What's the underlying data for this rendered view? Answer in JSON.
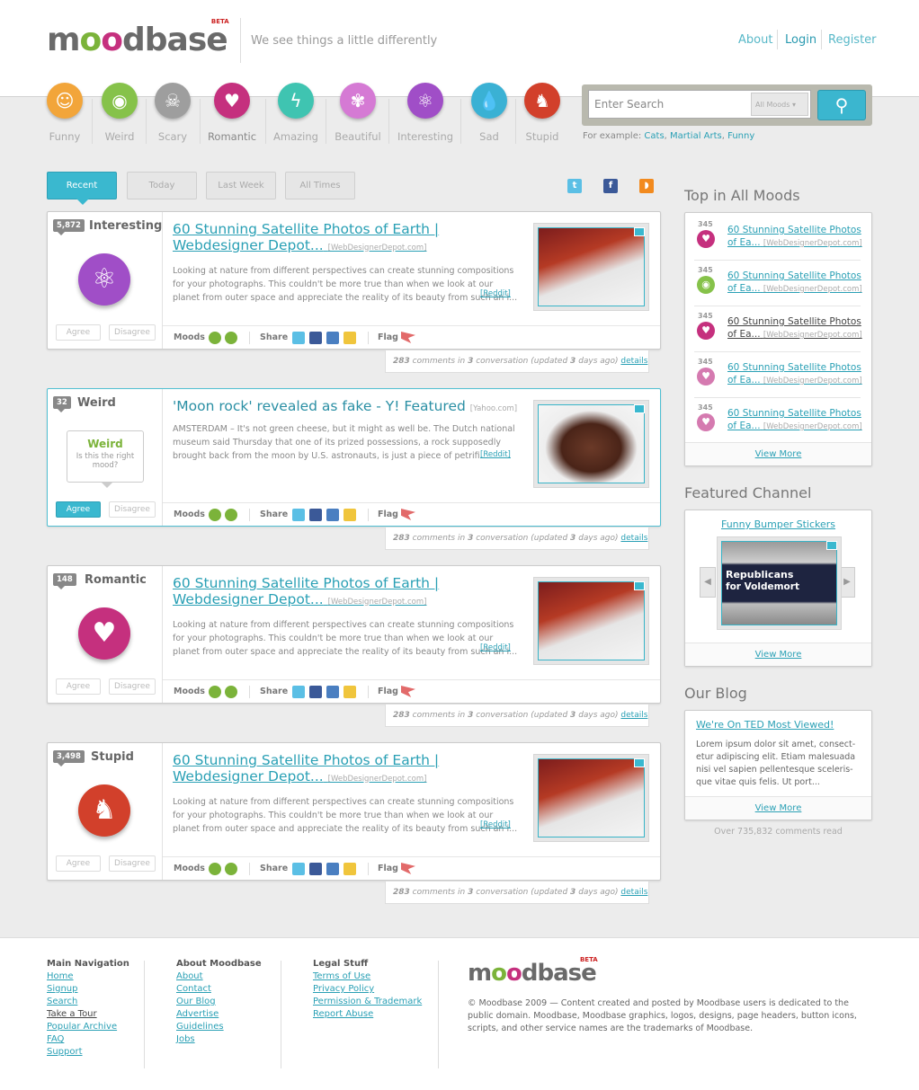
{
  "header": {
    "logo": "moodbase",
    "beta": "BETA",
    "tagline": "We see things a little differently",
    "links": [
      "About",
      "Login",
      "Register"
    ]
  },
  "moods": [
    {
      "label": "Funny",
      "icon": "smiley-icon",
      "color": "#f2a53a"
    },
    {
      "label": "Weird",
      "icon": "eye-icon",
      "color": "#86c24a"
    },
    {
      "label": "Scary",
      "icon": "skull-icon",
      "color": "#9e9e9e"
    },
    {
      "label": "Romantic",
      "icon": "heart-icon",
      "color": "#c5307e"
    },
    {
      "label": "Amazing",
      "icon": "lightning-icon",
      "color": "#3fc4b1"
    },
    {
      "label": "Beautiful",
      "icon": "butterfly-icon",
      "color": "#d57ad4"
    },
    {
      "label": "Interesting",
      "icon": "atom-icon",
      "color": "#a04ec7"
    },
    {
      "label": "Sad",
      "icon": "drop-icon",
      "color": "#3ab1d4"
    },
    {
      "label": "Stupid",
      "icon": "donkey-icon",
      "color": "#d2402b"
    }
  ],
  "search": {
    "placeholder": "Enter Search",
    "mood_select": "All Moods",
    "example_label": "For example:",
    "examples": [
      "Cats",
      "Martial Arts",
      "Funny"
    ]
  },
  "tabs": [
    "Recent",
    "Today",
    "Last Week",
    "All Times"
  ],
  "stories": [
    {
      "count": "5,872",
      "mood": "Interesting",
      "title": "60 Stunning Satellite Photos of Earth | Webdesigner Depot...",
      "source": "[WebDesignerDepot.com]",
      "excerpt": "Looking at nature from different perspectives can create stunning compositions for your photographs. This couldn't be more true than when we look at our planet from outer space and appreciate the reality of its beauty from such an i...",
      "reddit": "[Reddit]",
      "agree": "Agree",
      "disagree": "Disagree",
      "comments": "283",
      "conversations": "3",
      "updated": "3"
    },
    {
      "count": "32",
      "mood": "Weird",
      "title": "'Moon rock' revealed as fake - Y! Featured",
      "source": "[Yahoo.com]",
      "excerpt": "AMSTERDAM – It's not green cheese, but it might as well be. The Dutch national museum said Thursday that one of its prized possessions, a rock supposedly brought back from the moon by U.S. astronauts, is just a piece of petrifi...",
      "reddit": "[Reddit]",
      "agree": "Agree",
      "disagree": "Disagree",
      "bubble_title": "Weird",
      "bubble_text": "Is this the right mood?",
      "comments": "283",
      "conversations": "3",
      "updated": "3"
    },
    {
      "count": "148",
      "mood": "Romantic",
      "title": "60 Stunning Satellite Photos of Earth | Webdesigner Depot...",
      "source": "[WebDesignerDepot.com]",
      "excerpt": "Looking at nature from different perspectives can create stunning compositions for your photographs. This couldn't be more true than when we look at our planet from outer space and appreciate the reality of its beauty from such an i...",
      "reddit": "[Reddit]",
      "agree": "Agree",
      "disagree": "Disagree",
      "comments": "283",
      "conversations": "3",
      "updated": "3"
    },
    {
      "count": "3,498",
      "mood": "Stupid",
      "title": "60 Stunning Satellite Photos of Earth | Webdesigner Depot...",
      "source": "[WebDesignerDepot.com]",
      "excerpt": "Looking at nature from different perspectives can create stunning compositions for your photographs. This couldn't be more true than when we look at our planet from outer space and appreciate the reality of its beauty from such an i...",
      "reddit": "[Reddit]",
      "agree": "Agree",
      "disagree": "Disagree",
      "comments": "283",
      "conversations": "3",
      "updated": "3"
    }
  ],
  "card_labels": {
    "moods": "Moods",
    "share": "Share",
    "flag": "Flag",
    "comments_suffix": "comments in",
    "conv_suffix": "conversation (updated",
    "days_suffix": "days ago)",
    "details": "details"
  },
  "sidebar": {
    "top_title": "Top in All Moods",
    "top_items": [
      {
        "count": "345",
        "title": "60 Stunning Satellite Photos of Ea...",
        "source": "[WebDesignerDepot.com]"
      },
      {
        "count": "345",
        "title": "60 Stunning Satellite Photos of Ea...",
        "source": "[WebDesignerDepot.com]"
      },
      {
        "count": "345",
        "title": "60 Stunning Satellite Photos of Ea...",
        "source": "[WebDesignerDepot.com]"
      },
      {
        "count": "345",
        "title": "60 Stunning Satellite Photos of Ea...",
        "source": "[WebDesignerDepot.com]"
      },
      {
        "count": "345",
        "title": "60 Stunning Satellite Photos of Ea...",
        "source": "[WebDesignerDepot.com]"
      }
    ],
    "view_more": "View More",
    "featured_title": "Featured Channel",
    "featured_channel": "Funny Bumper Stickers",
    "sticker_line1": "Republicans",
    "sticker_line2": "for Voldemort",
    "blog_title": "Our Blog",
    "blog_post_title": "We're On TED Most Viewed!",
    "blog_post_text": "Lorem ipsum dolor sit amet, consect-etur adipiscing elit. Etiam malesuada nisi vel sapien pellentesque sceleris-que vitae quis felis. Ut port...",
    "comments_read": "Over 735,832 comments read"
  },
  "footer": {
    "nav_title": "Main Navigation",
    "nav": [
      "Home",
      "Signup",
      "Search",
      "Take a Tour",
      "Popular Archive",
      "FAQ",
      "Support"
    ],
    "about_title": "About Moodbase",
    "about": [
      "About",
      "Contact",
      "Our Blog",
      "Advertise",
      "Guidelines",
      "Jobs"
    ],
    "legal_title": "Legal Stuff",
    "legal": [
      "Terms of Use",
      "Privacy Policy",
      "Permission & Trademark",
      "Report Abuse"
    ],
    "copyright": "© Moodbase 2009 — Content created and posted by Moodbase users is dedicated to the public domain. Moodbase, Moodbase graphics, logos, designs, page headers, button icons, scripts, and other service names are the trademarks of Moodbase."
  }
}
